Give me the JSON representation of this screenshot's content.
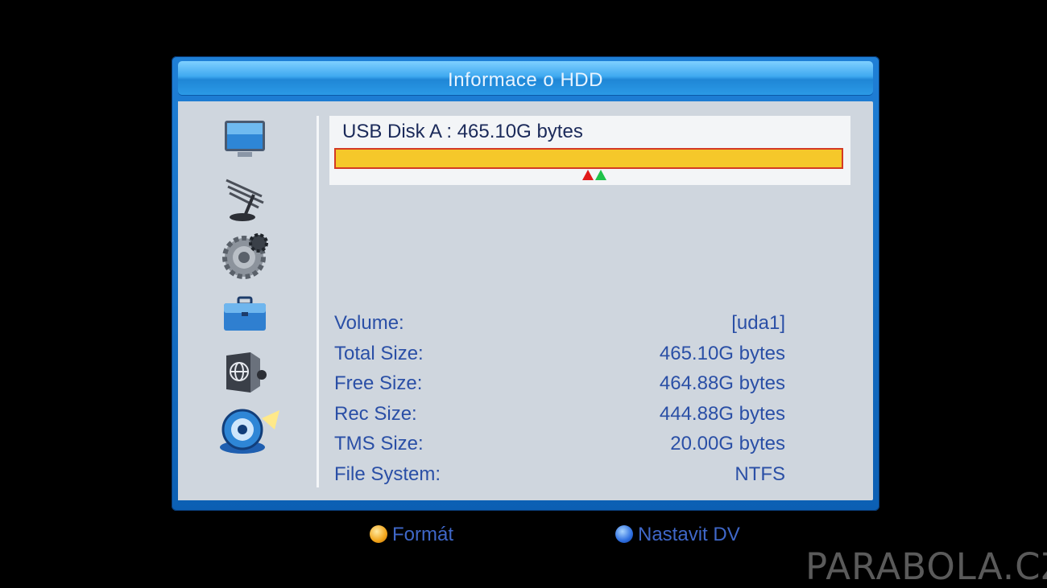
{
  "window": {
    "title": "Informace o HDD"
  },
  "disk": {
    "label": "USB Disk A : 465.10G bytes",
    "used_fraction": 0.0005
  },
  "sidebar": {
    "icons": [
      {
        "name": "tv-icon"
      },
      {
        "name": "satellite-dish-icon"
      },
      {
        "name": "gear-icon"
      },
      {
        "name": "toolbox-icon"
      },
      {
        "name": "network-globe-icon"
      },
      {
        "name": "media-disk-icon"
      }
    ]
  },
  "info": {
    "rows": [
      {
        "label": "Volume:",
        "value": "[uda1]"
      },
      {
        "label": "Total Size:",
        "value": "465.10G bytes"
      },
      {
        "label": "Free Size:",
        "value": "464.88G bytes"
      },
      {
        "label": "Rec Size:",
        "value": "444.88G bytes"
      },
      {
        "label": "TMS Size:",
        "value": "20.00G bytes"
      },
      {
        "label": "File System:",
        "value": "NTFS"
      }
    ]
  },
  "footer": {
    "format_label": "Formát",
    "format_color": "yellow",
    "dvr_label": "Nastavit DV",
    "dvr_color": "blue"
  },
  "watermark": "PARABOLA.CZ",
  "colors": {
    "bar_fill": "#f5c82a",
    "bar_border": "#d33a24",
    "marker_rec": "#e01919",
    "marker_tms": "#1fc24a"
  }
}
